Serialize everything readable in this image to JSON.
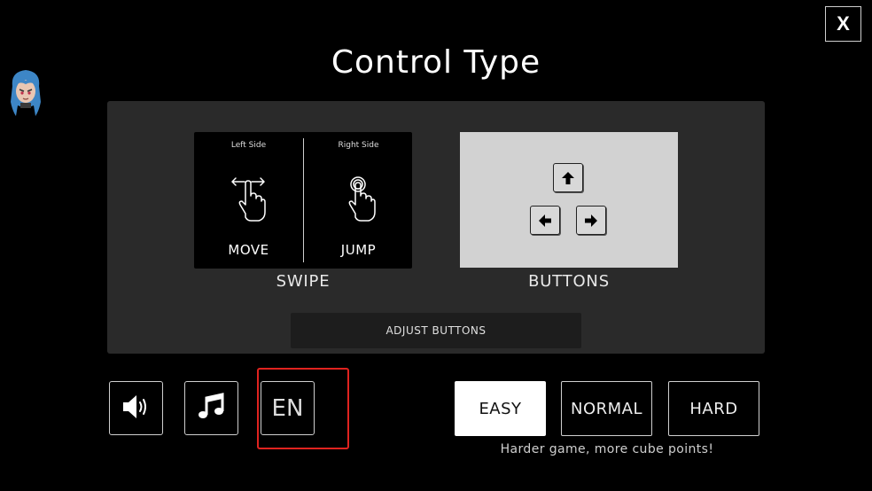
{
  "header": {
    "title": "Control Type",
    "close_label": "X"
  },
  "avatar": {
    "icon": "character-avatar-icon"
  },
  "control_options": {
    "swipe": {
      "label": "SWIPE",
      "left_side": {
        "caption": "Left Side",
        "action": "MOVE",
        "icon": "swipe-hand-icon"
      },
      "right_side": {
        "caption": "Right Side",
        "action": "JUMP",
        "icon": "tap-hand-icon"
      }
    },
    "buttons": {
      "label": "BUTTONS",
      "keys": [
        "arrow-up-icon",
        "arrow-left-icon",
        "arrow-right-icon"
      ]
    },
    "adjust_label": "ADJUST BUTTONS"
  },
  "settings": {
    "sound_icon": "speaker-icon",
    "music_icon": "music-note-icon",
    "language": "EN"
  },
  "difficulty": {
    "options": [
      "EASY",
      "NORMAL",
      "HARD"
    ],
    "selected": "EASY",
    "hint": "Harder game, more cube points!"
  },
  "colors": {
    "background": "#000000",
    "panel": "#2a2a2a",
    "highlight": "#e0231f",
    "active_button": "#ffffff"
  }
}
